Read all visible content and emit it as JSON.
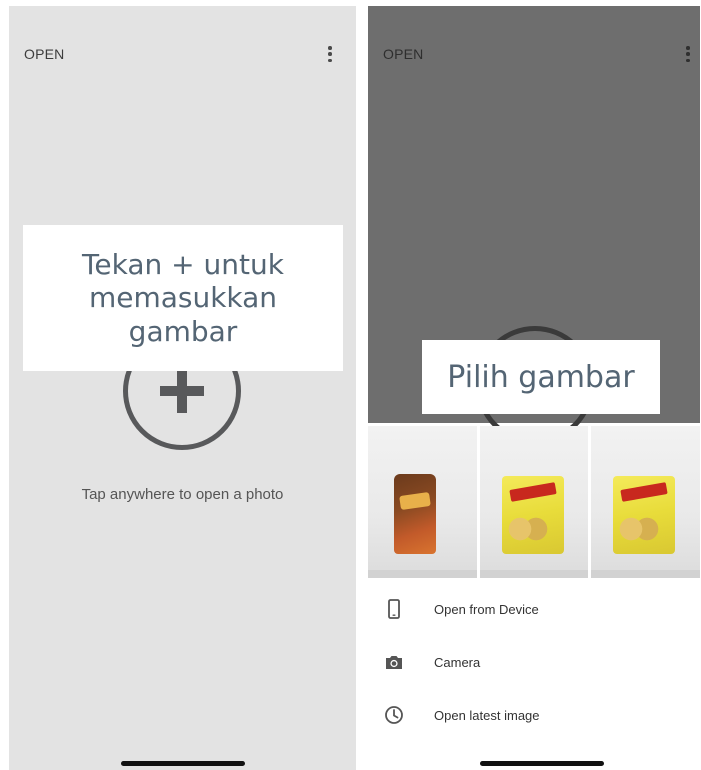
{
  "left_screen": {
    "topbar": {
      "title": "OPEN",
      "menu_icon": "more-vert-icon"
    },
    "add_icon": "add-circle-icon",
    "hint": "Tap anywhere to open a photo",
    "callout": "Tekan + untuk\nmemasukkan\ngambar"
  },
  "right_screen": {
    "topbar": {
      "title": "OPEN",
      "menu_icon": "more-vert-icon"
    },
    "callout": "Pilih gambar",
    "thumbnails": [
      {
        "icon": "photo-thumbnail-brown-snack"
      },
      {
        "icon": "photo-thumbnail-yellow-snack"
      },
      {
        "icon": "photo-thumbnail-yellow-snack"
      }
    ],
    "menu": [
      {
        "icon": "smartphone-icon",
        "label": "Open from Device"
      },
      {
        "icon": "camera-icon",
        "label": "Camera"
      },
      {
        "icon": "clock-icon",
        "label": "Open latest image"
      }
    ]
  },
  "colors": {
    "left_background": "#e3e3e3",
    "scrim": "#6e6e6e",
    "callout_text": "#546574",
    "icon_gray": "#58595b"
  }
}
